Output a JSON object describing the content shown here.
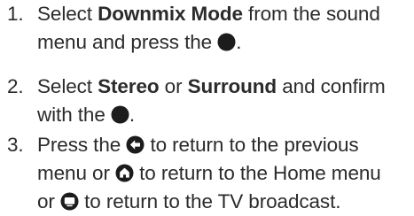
{
  "steps": [
    {
      "number": "1.",
      "line1_pre": "Select ",
      "line1_bold": "Downmix Mode",
      "line1_post": " from the sound",
      "line2_pre": "menu and press the ",
      "line2_post": ".",
      "icon": "ok-button-icon"
    },
    {
      "number": "2.",
      "line1_pre": "Select ",
      "line1_bold1": "Stereo",
      "line1_mid": " or ",
      "line1_bold2": "Surround",
      "line1_post": " and confirm",
      "line2_pre": "with the ",
      "line2_post": ".",
      "icon": "ok-button-icon"
    },
    {
      "number": "3.",
      "line1_pre": "Press the ",
      "line1_post": " to return to the previous",
      "line2_pre": "menu or ",
      "line2_post": " to return to the Home menu",
      "line3_pre": "or ",
      "line3_post": " to return to the TV broadcast.",
      "icons": [
        "back-button-icon",
        "home-button-icon",
        "tv-button-icon"
      ]
    }
  ],
  "colors": {
    "text": "#2b2b2b",
    "icon": "#1c1c1c"
  }
}
